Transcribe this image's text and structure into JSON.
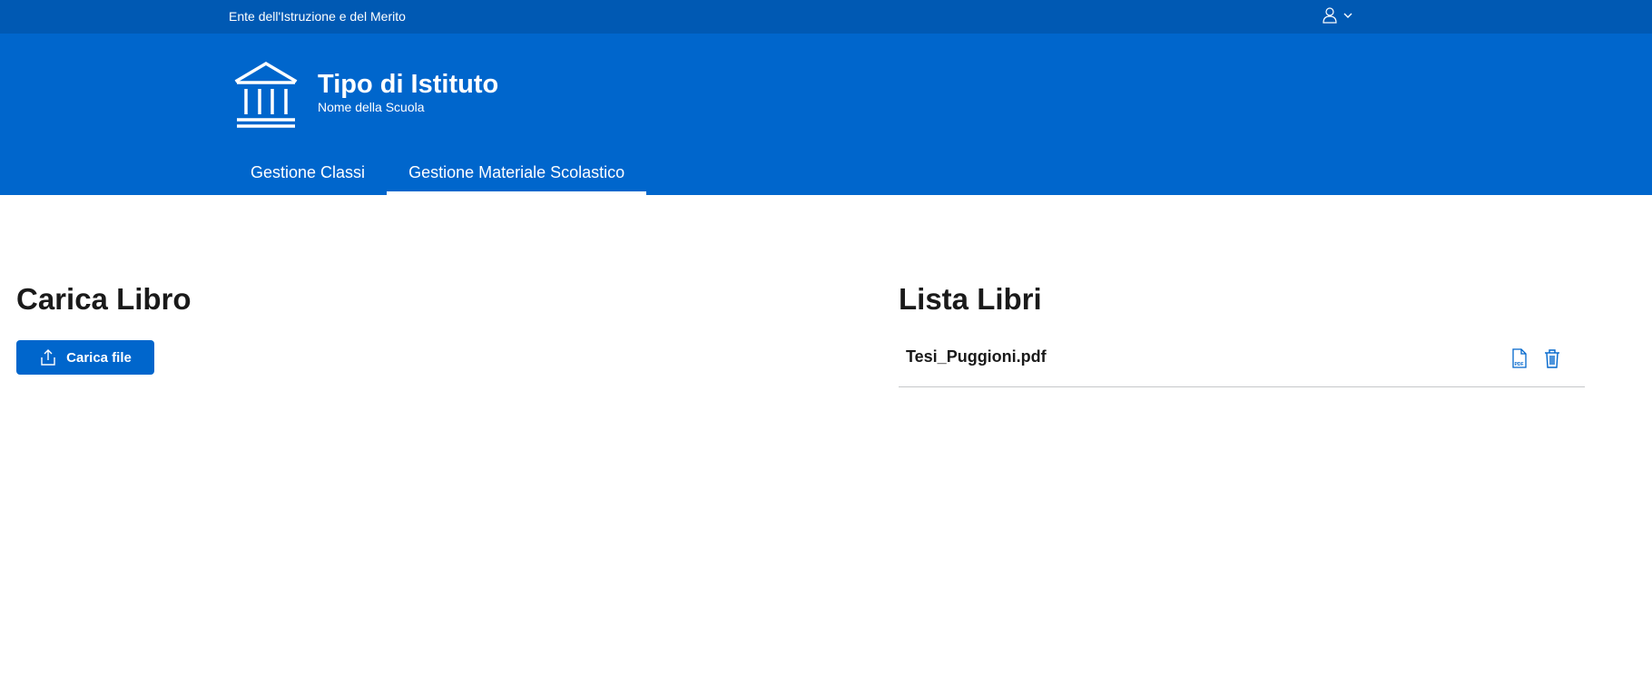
{
  "slim_header": {
    "title": "Ente dell'Istruzione e del Merito",
    "user_icon": "user-icon",
    "user_chevron_icon": "chevron-down-icon"
  },
  "brand": {
    "icon": "institution-icon",
    "title": "Tipo di Istituto",
    "subtitle": "Nome della Scuola"
  },
  "nav": {
    "items": [
      {
        "label": "Gestione Classi",
        "active": false
      },
      {
        "label": "Gestione Materiale Scolastico",
        "active": true
      }
    ]
  },
  "upload": {
    "title": "Carica Libro",
    "button_label": "Carica file",
    "button_icon": "upload-icon"
  },
  "books": {
    "title": "Lista Libri",
    "files": [
      {
        "name": "Tesi_Puggioni.pdf",
        "view_icon": "pdf-file-icon",
        "delete_icon": "trash-icon"
      }
    ]
  },
  "colors": {
    "primary": "#0066cc",
    "slim_header": "#0059b3",
    "text": "#1a1a1a",
    "divider": "#c5c7c9"
  }
}
